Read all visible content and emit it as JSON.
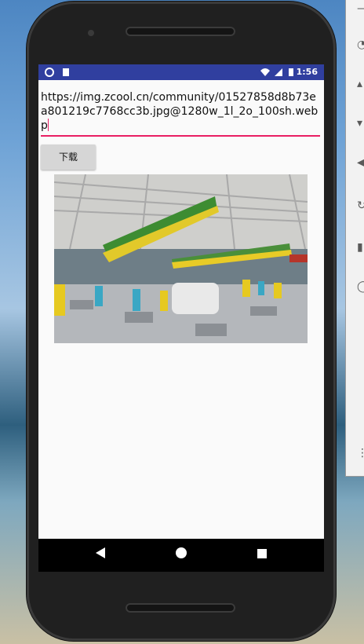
{
  "statusbar": {
    "time": "1:56"
  },
  "url_input": {
    "value": "https://img.zcool.cn/community/01527858d8b73ea801219c7768cc3b.jpg@1280w_1l_2o_100sh.webp"
  },
  "download_button": {
    "label": "下载"
  },
  "image": {
    "description_name": "downloaded-restaurant-image"
  },
  "colors": {
    "statusbar": "#303f9f",
    "accent": "#e91e63",
    "button": "#d6d6d6"
  },
  "icons": {
    "status_left": [
      "circle-icon",
      "sim-icon"
    ],
    "status_right": [
      "wifi-icon",
      "signal-icon",
      "battery-icon"
    ],
    "nav": [
      "back-icon",
      "home-icon",
      "recents-icon"
    ]
  }
}
